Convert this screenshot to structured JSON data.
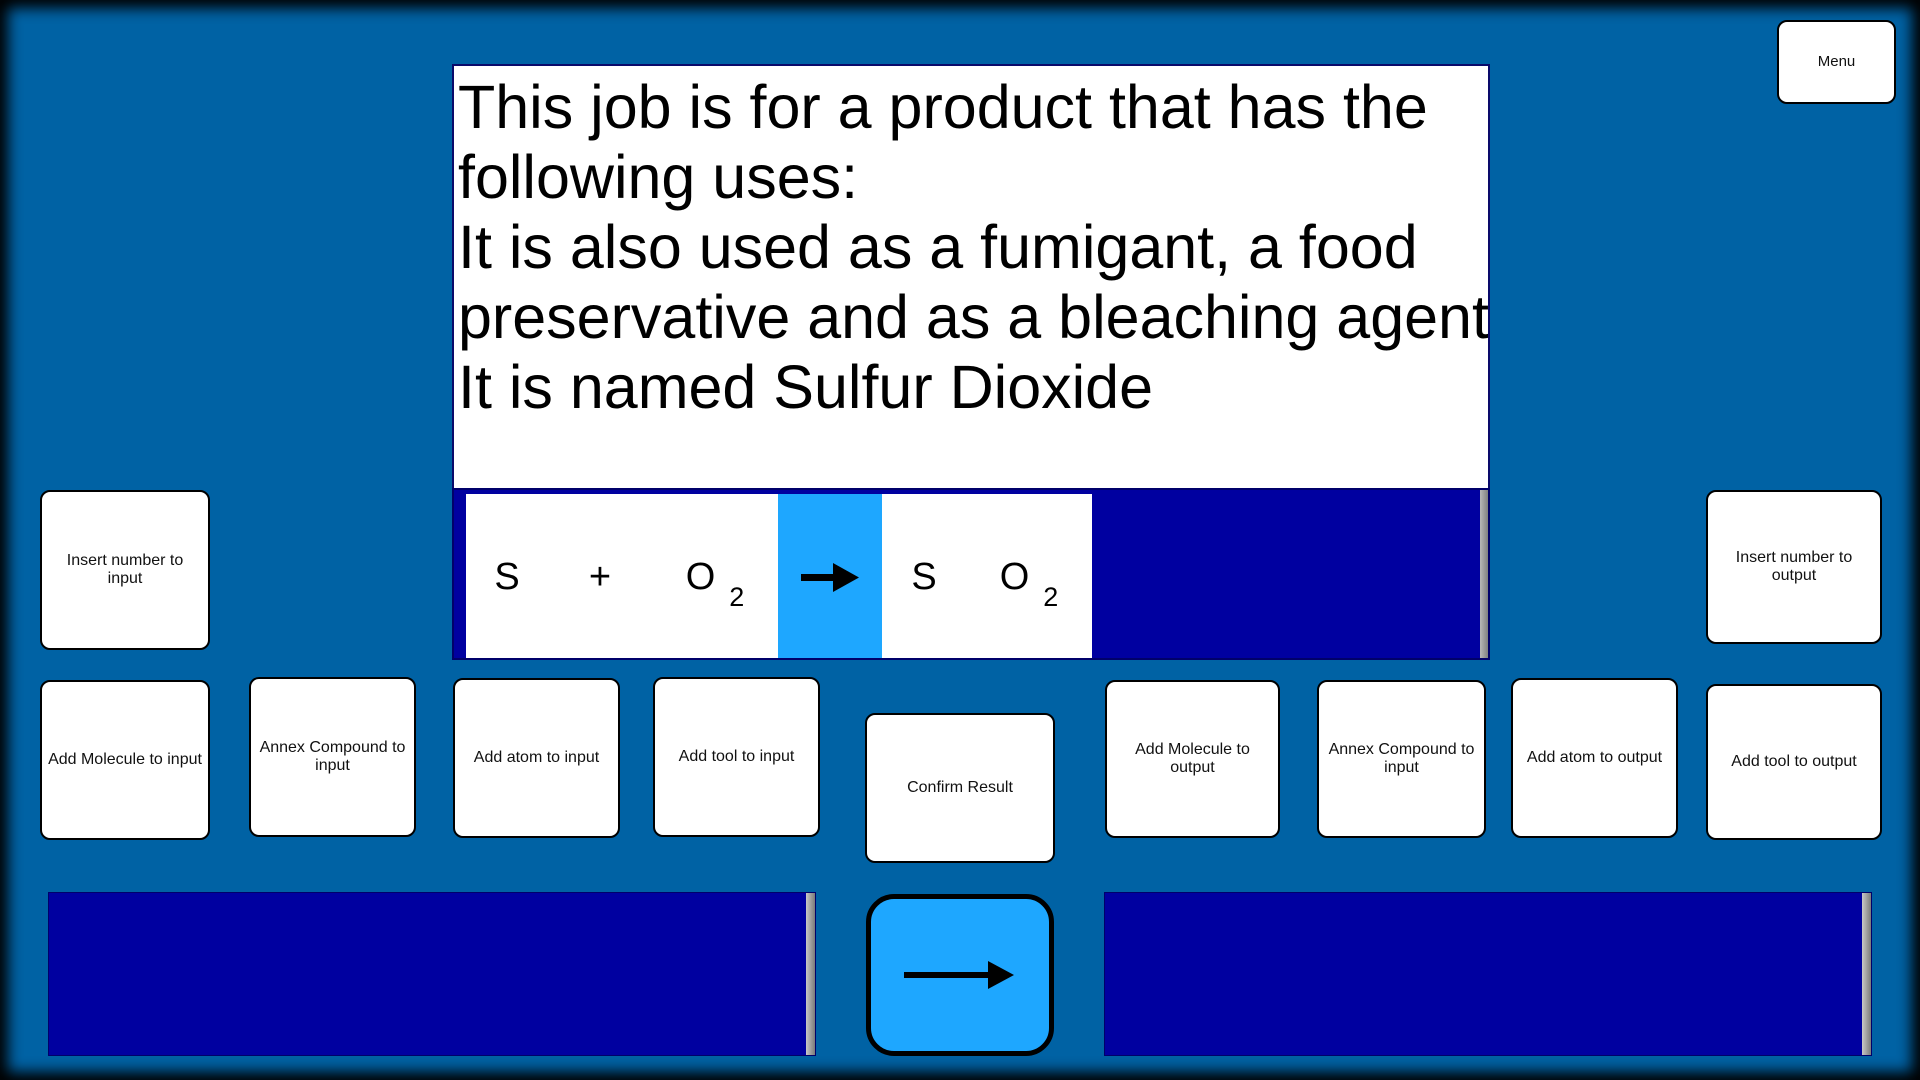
{
  "menu": {
    "label": "Menu"
  },
  "job": {
    "lines": [
      "This job is for a product that has the",
      "following uses:",
      "It is also used as a fumigant, a food",
      "preservative and as a bleaching agent",
      "It is named Sulfur Dioxide"
    ]
  },
  "equation": {
    "reactant_1": "S",
    "plus": "+",
    "reactant_2": "O",
    "reactant_2_sub": "2",
    "product_1": "S",
    "product_2": "O",
    "product_2_sub": "2",
    "arrow_icon": "arrow-right-icon",
    "arrow_color": "#1ea7ff"
  },
  "input_controls": {
    "insert_number": "Insert number to input",
    "add_molecule": "Add Molecule to input",
    "annex_compound": "Annex Compound to input",
    "add_atom": "Add atom to input",
    "add_tool": "Add tool to input"
  },
  "confirm": {
    "label": "Confirm Result"
  },
  "output_controls": {
    "insert_number": "Insert number to output",
    "add_molecule": "Add Molecule to output",
    "annex_compound": "Annex Compound to input",
    "add_atom": "Add atom to output",
    "add_tool": "Add tool to output"
  },
  "colors": {
    "background": "#0062a4",
    "panel": "#0000a0",
    "accent": "#1ea7ff"
  }
}
